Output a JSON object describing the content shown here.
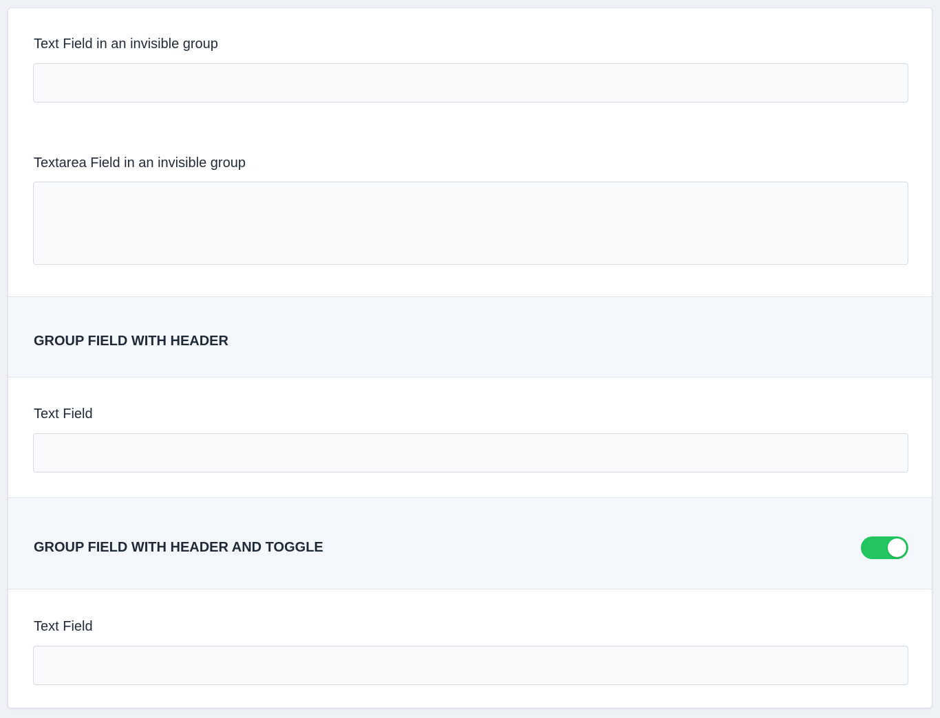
{
  "colors": {
    "page_background": "#eef1f5",
    "card_background": "#ffffff",
    "header_background": "#f4f7fb",
    "input_background": "#f9fafc",
    "border": "#d5dbe3",
    "text": "#1f2937",
    "toggle_on": "#22c55e"
  },
  "fields": {
    "text_field_invisible": {
      "label": "Text Field in an invisible group",
      "value": "",
      "placeholder": ""
    },
    "textarea_field_invisible": {
      "label": "Textarea Field in an invisible group",
      "value": "",
      "placeholder": ""
    }
  },
  "groups": [
    {
      "title": "GROUP FIELD WITH HEADER",
      "field": {
        "label": "Text Field",
        "value": "",
        "placeholder": ""
      }
    },
    {
      "title": "GROUP FIELD WITH HEADER AND TOGGLE",
      "toggle": {
        "icon": "toggle-switch-on",
        "state": "on"
      },
      "field": {
        "label": "Text Field",
        "value": "",
        "placeholder": ""
      }
    }
  ]
}
